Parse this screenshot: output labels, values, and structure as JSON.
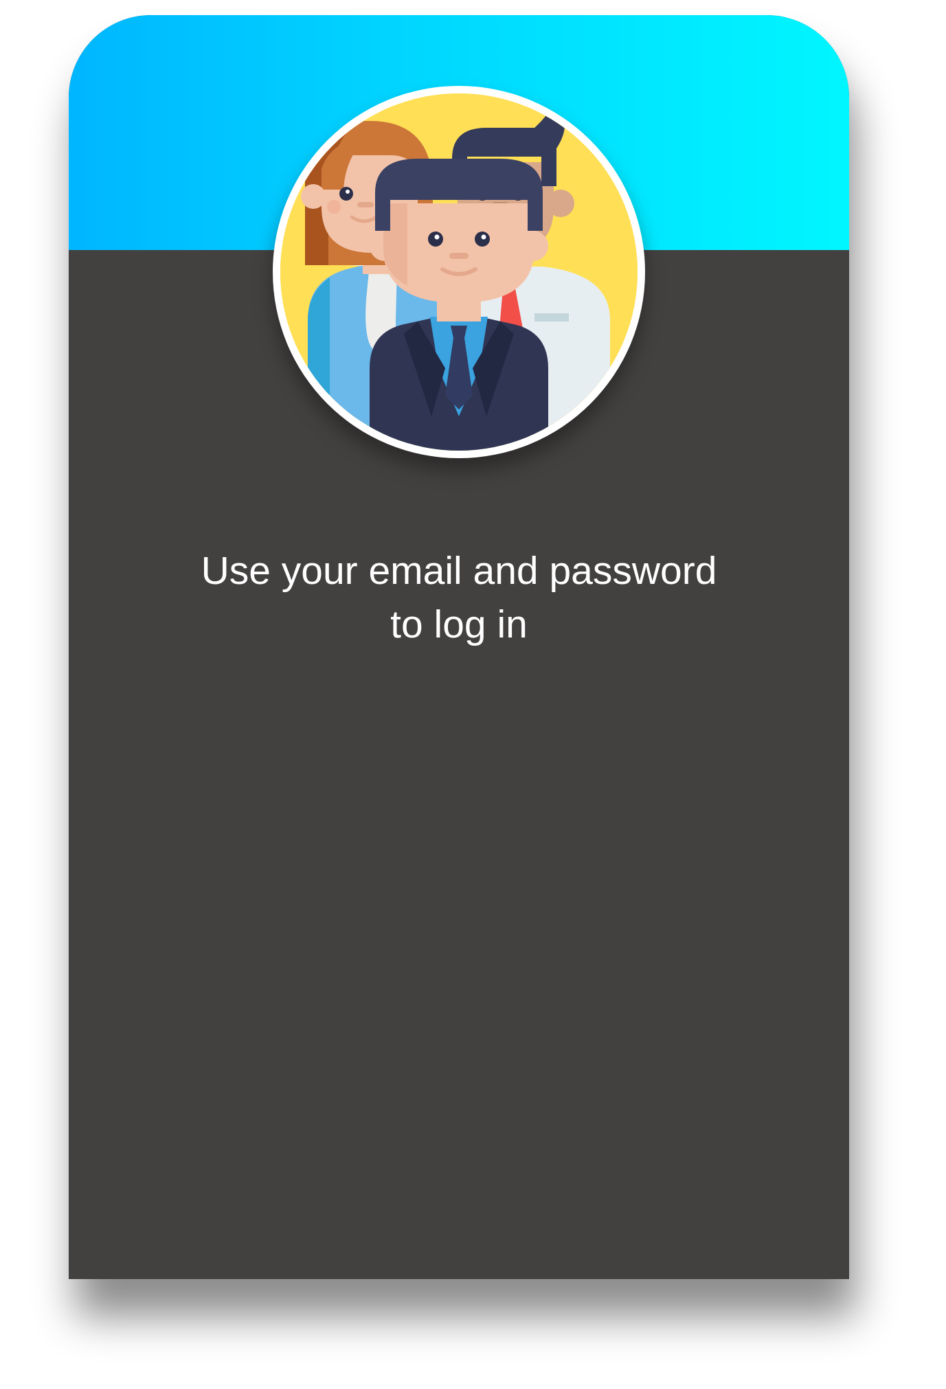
{
  "screen": {
    "header_gradient": [
      "#00b6ff",
      "#00f6ff"
    ],
    "panel_color": "#434140",
    "avatar_bg_color": "#ffdf55"
  },
  "avatar": {
    "icon": "group-people-icon"
  },
  "message": {
    "line1": "Use your email and password",
    "line2": "to log in"
  }
}
